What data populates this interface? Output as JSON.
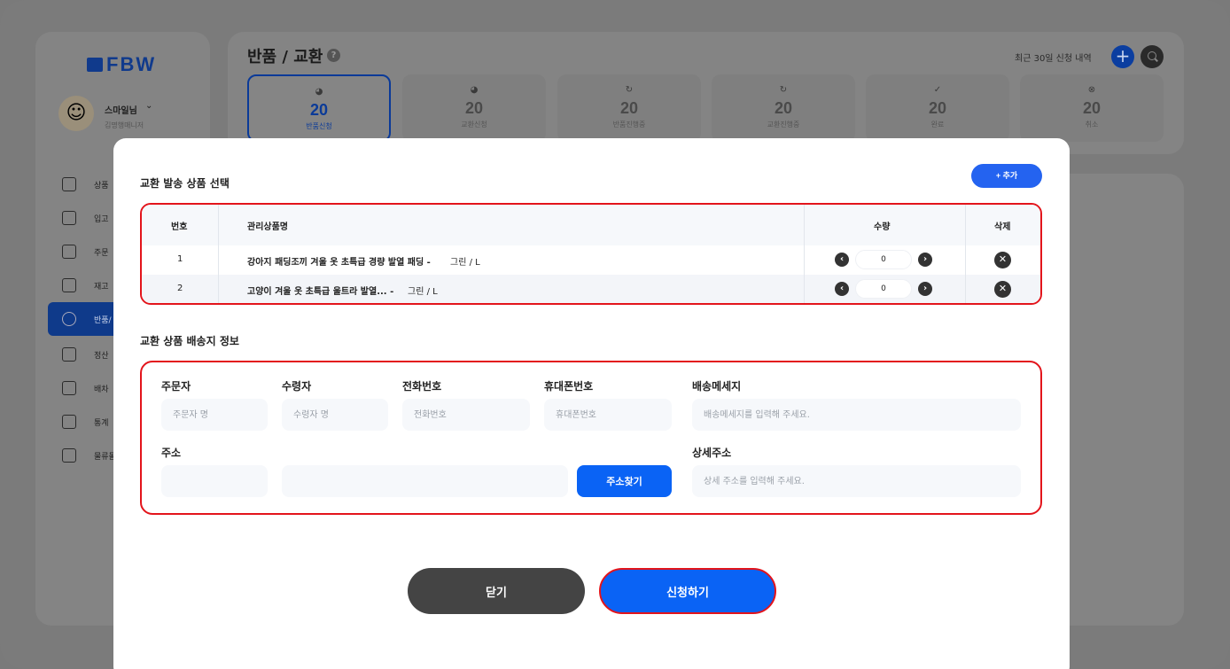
{
  "app": {
    "logo": "FBW"
  },
  "profile": {
    "name": "스마일님",
    "role": "김명행매니저",
    "avatar": "☺"
  },
  "sidebar": {
    "items": [
      {
        "label": "상품",
        "icon": "box-icon"
      },
      {
        "label": "입고",
        "icon": "warehouse-icon"
      },
      {
        "label": "주문",
        "icon": "document-icon"
      },
      {
        "label": "재고",
        "icon": "grid-icon"
      },
      {
        "label": "반품/",
        "icon": "return-icon"
      },
      {
        "label": "정산",
        "icon": "card-icon"
      },
      {
        "label": "배차",
        "icon": "car-icon"
      },
      {
        "label": "통계",
        "icon": "chart-icon"
      },
      {
        "label": "물류몰",
        "icon": "chat-icon"
      }
    ]
  },
  "header": {
    "title": "반품 / 교환",
    "recent_link": "최근 30일 신청 내역"
  },
  "stats": [
    {
      "value": "20",
      "label": "반품신청",
      "icon": "◕"
    },
    {
      "value": "20",
      "label": "교환신청",
      "icon": "◕"
    },
    {
      "value": "20",
      "label": "반품진행중",
      "icon": "↻"
    },
    {
      "value": "20",
      "label": "교환진행중",
      "icon": "↻"
    },
    {
      "value": "20",
      "label": "완료",
      "icon": "✓"
    },
    {
      "value": "20",
      "label": "취소",
      "icon": "⊗"
    }
  ],
  "modal": {
    "section1_title": "교환 발송 상품 선택",
    "add_button": "+ 추가",
    "table": {
      "headers": {
        "no": "번호",
        "name": "관리상품명",
        "qty": "수량",
        "delete": "삭제"
      },
      "rows": [
        {
          "no": "1",
          "name": "강아지 패딩조끼 겨울 옷 초특급 경량 발열 패딩 -",
          "option": "그린 / L",
          "qty": "0"
        },
        {
          "no": "2",
          "name": "고양이 겨울 옷 초특급 울트라 발열... -",
          "option": "그린 / L",
          "qty": "0"
        }
      ]
    },
    "section2_title": "교환 상품 배송지 정보",
    "form": {
      "orderer_label": "주문자",
      "orderer_placeholder": "주문자 명",
      "receiver_label": "수령자",
      "receiver_placeholder": "수령자 명",
      "phone_label": "전화번호",
      "phone_placeholder": "전화번호",
      "mobile_label": "휴대폰번호",
      "mobile_placeholder": "휴대폰번호",
      "message_label": "배송메세지",
      "message_placeholder": "배송메세지를 입력해 주세요.",
      "address_label": "주소",
      "find_address_button": "주소찾기",
      "detail_label": "상세주소",
      "detail_placeholder": "상세 주소를 입력해 주세요."
    },
    "close_button": "닫기",
    "submit_button": "신청하기"
  }
}
